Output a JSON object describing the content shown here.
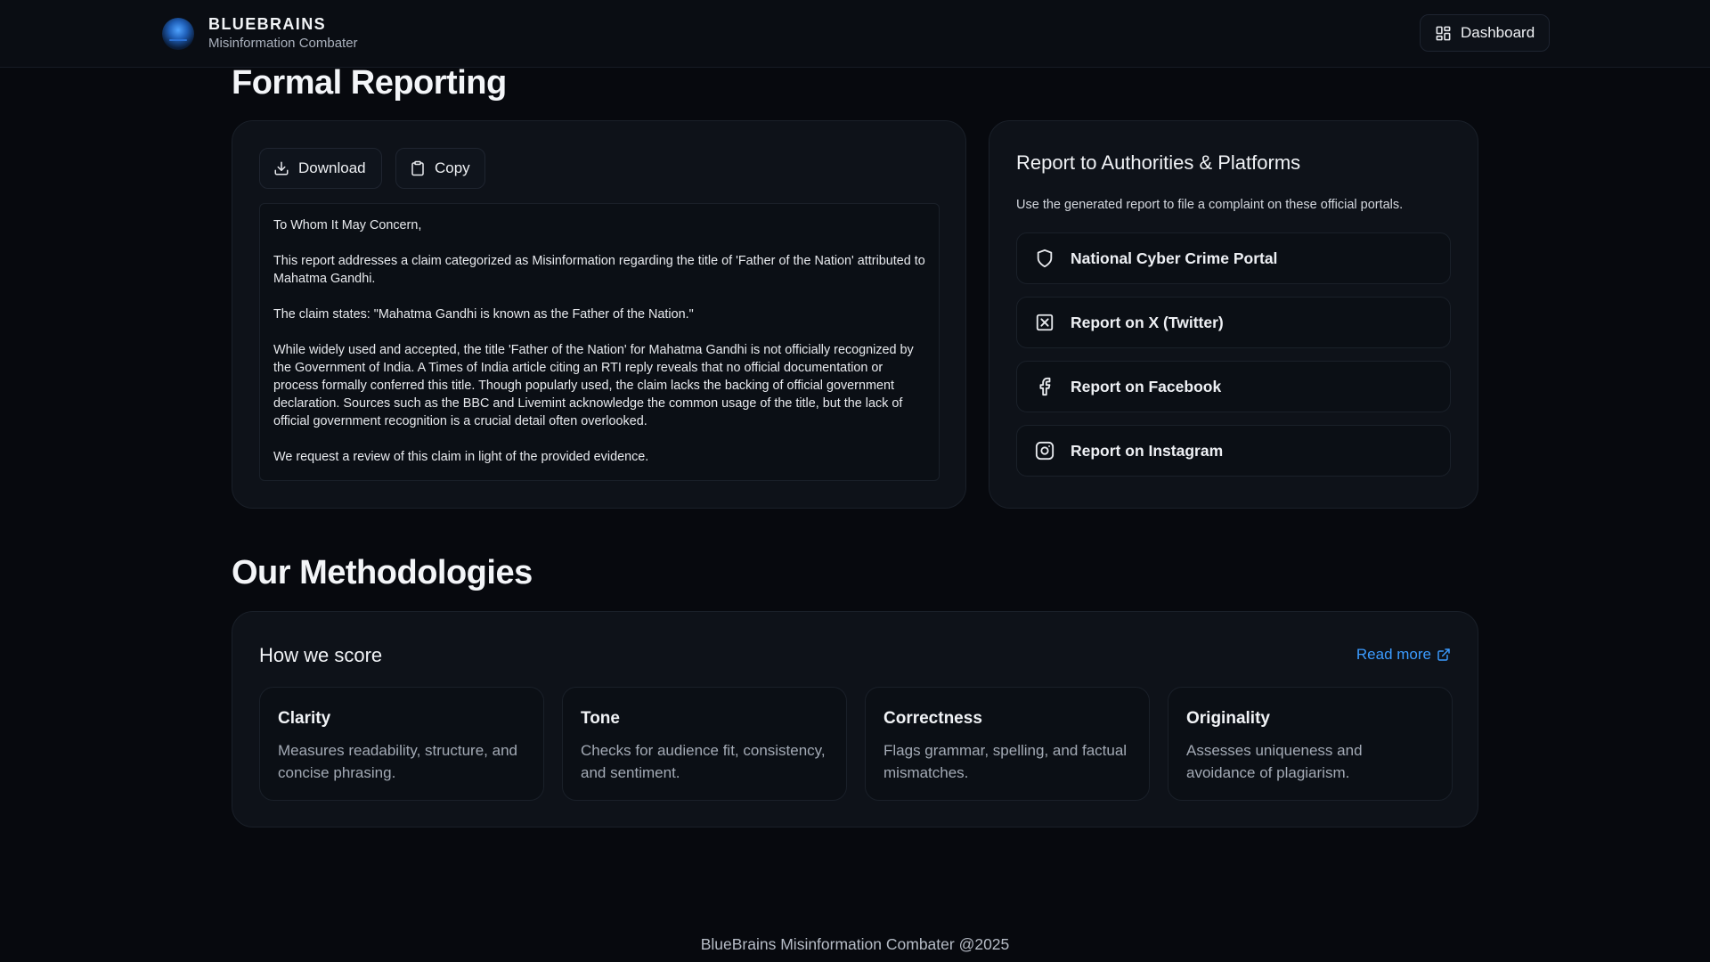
{
  "header": {
    "brand_name": "BLUEBRAINS",
    "brand_subtitle": "Misinformation Combater",
    "dashboard_label": "Dashboard"
  },
  "formal_reporting": {
    "title": "Formal Reporting",
    "download_label": "Download",
    "copy_label": "Copy",
    "report_paragraphs": [
      "To Whom It May Concern,",
      "This report addresses a claim categorized as Misinformation regarding the title of 'Father of the Nation' attributed to Mahatma Gandhi.",
      "The claim states: \"Mahatma Gandhi is known as the Father of the Nation.\"",
      "While widely used and accepted, the title 'Father of the Nation' for Mahatma Gandhi is not officially recognized by the Government of India.  A Times of India article citing an RTI reply reveals that no official documentation or process formally conferred this title.  Though popularly used, the claim lacks the backing of official government declaration.  Sources such as the BBC and Livemint acknowledge the common usage of the title, but the lack of official government recognition is a crucial detail often overlooked.",
      "We request a review of this claim in light of the provided evidence."
    ]
  },
  "authorities": {
    "title": "Report to Authorities & Platforms",
    "subtitle": "Use the generated report to file a complaint on these official portals.",
    "items": [
      {
        "label": "National Cyber Crime Portal",
        "icon": "shield-icon"
      },
      {
        "label": "Report on X (Twitter)",
        "icon": "x-icon"
      },
      {
        "label": "Report on Facebook",
        "icon": "facebook-icon"
      },
      {
        "label": "Report on Instagram",
        "icon": "instagram-icon"
      }
    ]
  },
  "methodologies": {
    "title": "Our Methodologies",
    "card_title": "How we score",
    "read_more_label": "Read more",
    "criteria": [
      {
        "title": "Clarity",
        "description": "Measures readability, structure, and concise phrasing."
      },
      {
        "title": "Tone",
        "description": "Checks for audience fit, consistency, and sentiment."
      },
      {
        "title": "Correctness",
        "description": "Flags grammar, spelling, and factual mismatches."
      },
      {
        "title": "Originality",
        "description": "Assesses uniqueness and avoidance of plagiarism."
      }
    ]
  },
  "footer": {
    "text": "BlueBrains Misinformation Combater @2025"
  },
  "colors": {
    "background": "#07090e",
    "card": "#0e1219",
    "accent_link": "#3b9bff"
  }
}
